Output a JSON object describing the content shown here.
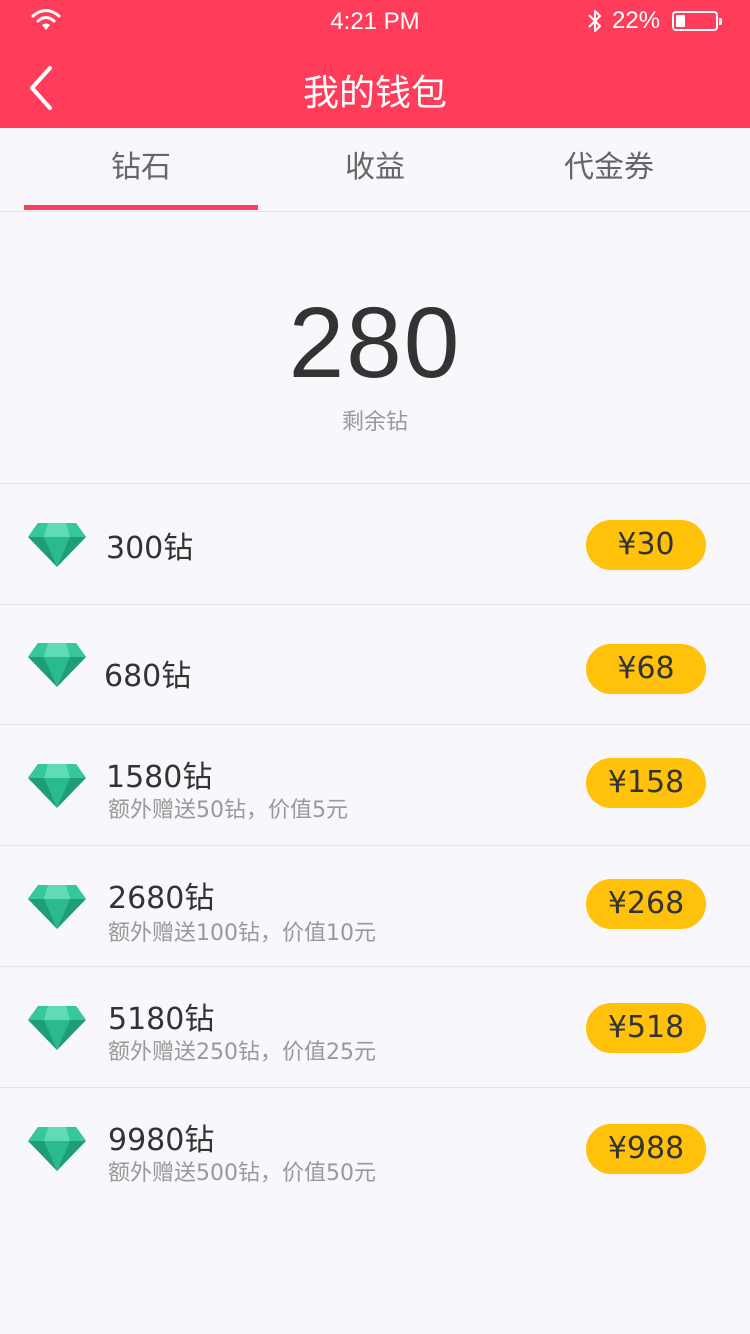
{
  "status": {
    "time": "4:21 PM",
    "battery_pct": "22%",
    "battery_level": 0.22
  },
  "nav": {
    "title": "我的钱包",
    "back_icon": "chevron-left-icon"
  },
  "tabs": [
    {
      "label": "钻石",
      "active": true
    },
    {
      "label": "收益",
      "active": false
    },
    {
      "label": "代金券",
      "active": false
    }
  ],
  "balance": {
    "value": "280",
    "label": "剩余钻"
  },
  "packages": [
    {
      "amount": "300钻",
      "bonus": "",
      "price": "¥30"
    },
    {
      "amount": "680钻",
      "bonus": "",
      "price": "¥68"
    },
    {
      "amount": "1580钻",
      "bonus": "额外赠送50钻，价值5元",
      "price": "¥158"
    },
    {
      "amount": "2680钻",
      "bonus": "额外赠送100钻，价值10元",
      "price": "¥268"
    },
    {
      "amount": "5180钻",
      "bonus": "额外赠送250钻，价值25元",
      "price": "¥518"
    },
    {
      "amount": "9980钻",
      "bonus": "额外赠送500钻，价值50元",
      "price": "¥988"
    }
  ],
  "colors": {
    "brand": "#ff3d5a",
    "background": "#f8f8fc",
    "price_button": "#ffc10a",
    "gem": "#2bb98f"
  }
}
